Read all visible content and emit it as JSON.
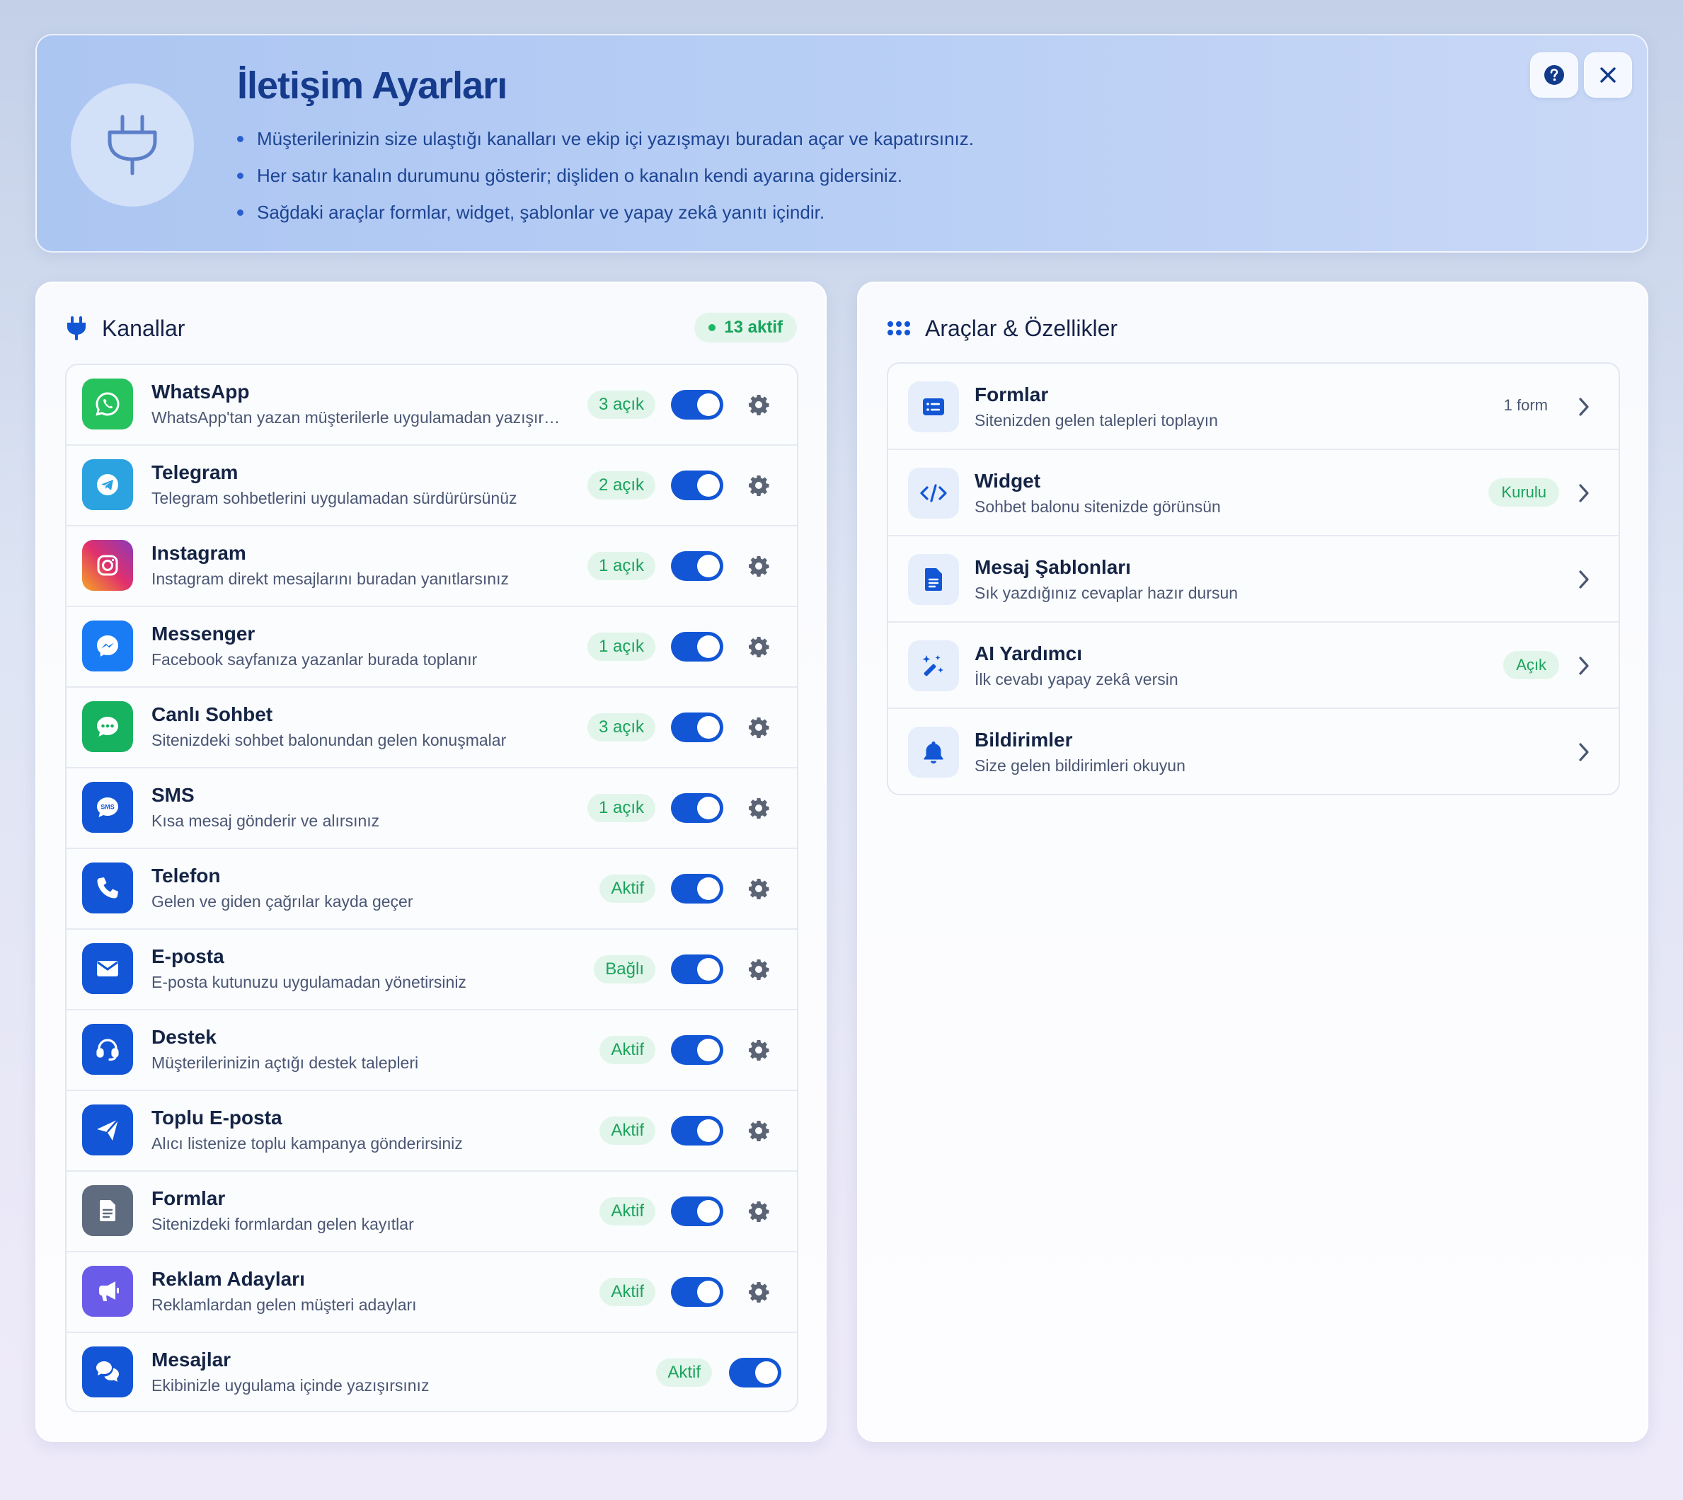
{
  "header": {
    "title": "İletişim Ayarları",
    "bullets": [
      "Müşterilerinizin size ulaştığı kanalları ve ekip içi yazışmayı buradan açar ve kapatırsınız.",
      "Her satır kanalın durumunu gösterir; dişliden o kanalın kendi ayarına gidersiniz.",
      "Sağdaki araçlar formlar, widget, şablonlar ve yapay zekâ yanıtı içindir."
    ],
    "icon": "plug-icon",
    "buttons": {
      "help_icon": "question-circle-icon",
      "close_icon": "close-icon"
    }
  },
  "channels": {
    "title": "Kanallar",
    "active_count": "13 aktif",
    "items": [
      {
        "name": "WhatsApp",
        "desc": "WhatsApp'tan yazan müşterilerle uygulamadan yazışırsınız",
        "status": "3 açık",
        "enabled": true,
        "icon": "whatsapp-icon",
        "color": "#25c25e"
      },
      {
        "name": "Telegram",
        "desc": "Telegram sohbetlerini uygulamadan sürdürürsünüz",
        "status": "2 açık",
        "enabled": true,
        "icon": "telegram-icon",
        "color": "#2aa3e0"
      },
      {
        "name": "Instagram",
        "desc": "Instagram direkt mesajlarını buradan yanıtlarsınız",
        "status": "1 açık",
        "enabled": true,
        "icon": "instagram-icon",
        "color": "#e1306c"
      },
      {
        "name": "Messenger",
        "desc": "Facebook sayfanıza yazanlar burada toplanır",
        "status": "1 açık",
        "enabled": true,
        "icon": "messenger-icon",
        "color": "#1a7cf4"
      },
      {
        "name": "Canlı Sohbet",
        "desc": "Sitenizdeki sohbet balonundan gelen konuşmalar",
        "status": "3 açık",
        "enabled": true,
        "icon": "chat-bubble-icon",
        "color": "#16b25f"
      },
      {
        "name": "SMS",
        "desc": "Kısa mesaj gönderir ve alırsınız",
        "status": "1 açık",
        "enabled": true,
        "icon": "sms-icon",
        "color": "#1255d6"
      },
      {
        "name": "Telefon",
        "desc": "Gelen ve giden çağrılar kayda geçer",
        "status": "Aktif",
        "enabled": true,
        "icon": "phone-icon",
        "color": "#1255d6"
      },
      {
        "name": "E-posta",
        "desc": "E-posta kutunuzu uygulamadan yönetirsiniz",
        "status": "Bağlı",
        "enabled": true,
        "icon": "envelope-icon",
        "color": "#1255d6"
      },
      {
        "name": "Destek",
        "desc": "Müşterilerinizin açtığı destek talepleri",
        "status": "Aktif",
        "enabled": true,
        "icon": "headset-icon",
        "color": "#1255d6"
      },
      {
        "name": "Toplu E-posta",
        "desc": "Alıcı listenize toplu kampanya gönderirsiniz",
        "status": "Aktif",
        "enabled": true,
        "icon": "paper-plane-icon",
        "color": "#1255d6"
      },
      {
        "name": "Formlar",
        "desc": "Sitenizdeki formlardan gelen kayıtlar",
        "status": "Aktif",
        "enabled": true,
        "icon": "document-icon",
        "color": "#5f6b7e"
      },
      {
        "name": "Reklam Adayları",
        "desc": "Reklamlardan gelen müşteri adayları",
        "status": "Aktif",
        "enabled": true,
        "icon": "megaphone-icon",
        "color": "#6a5ce8"
      },
      {
        "name": "Mesajlar",
        "desc": "Ekibinizle uygulama içinde yazışırsınız",
        "status": "Aktif",
        "enabled": true,
        "icon": "comments-icon",
        "color": "#1255d6"
      }
    ]
  },
  "tools": {
    "title": "Araçlar & Özellikler",
    "items": [
      {
        "name": "Formlar",
        "desc": "Sitenizden gelen talepleri toplayın",
        "meta": "1 form",
        "icon": "list-form-icon"
      },
      {
        "name": "Widget",
        "desc": "Sohbet balonu sitenizde görünsün",
        "pill": "Kurulu",
        "icon": "code-icon"
      },
      {
        "name": "Mesaj Şablonları",
        "desc": "Sık yazdığınız cevaplar hazır dursun",
        "icon": "file-text-icon"
      },
      {
        "name": "AI Yardımcı",
        "desc": "İlk cevabı yapay zekâ versin",
        "pill": "Açık",
        "icon": "magic-wand-icon"
      },
      {
        "name": "Bildirimler",
        "desc": "Size gelen bildirimleri okuyun",
        "icon": "bell-icon"
      }
    ]
  },
  "colors": {
    "accent": "#1256d6",
    "success": "#1aa35c",
    "success_bg": "#e2f5ea"
  }
}
